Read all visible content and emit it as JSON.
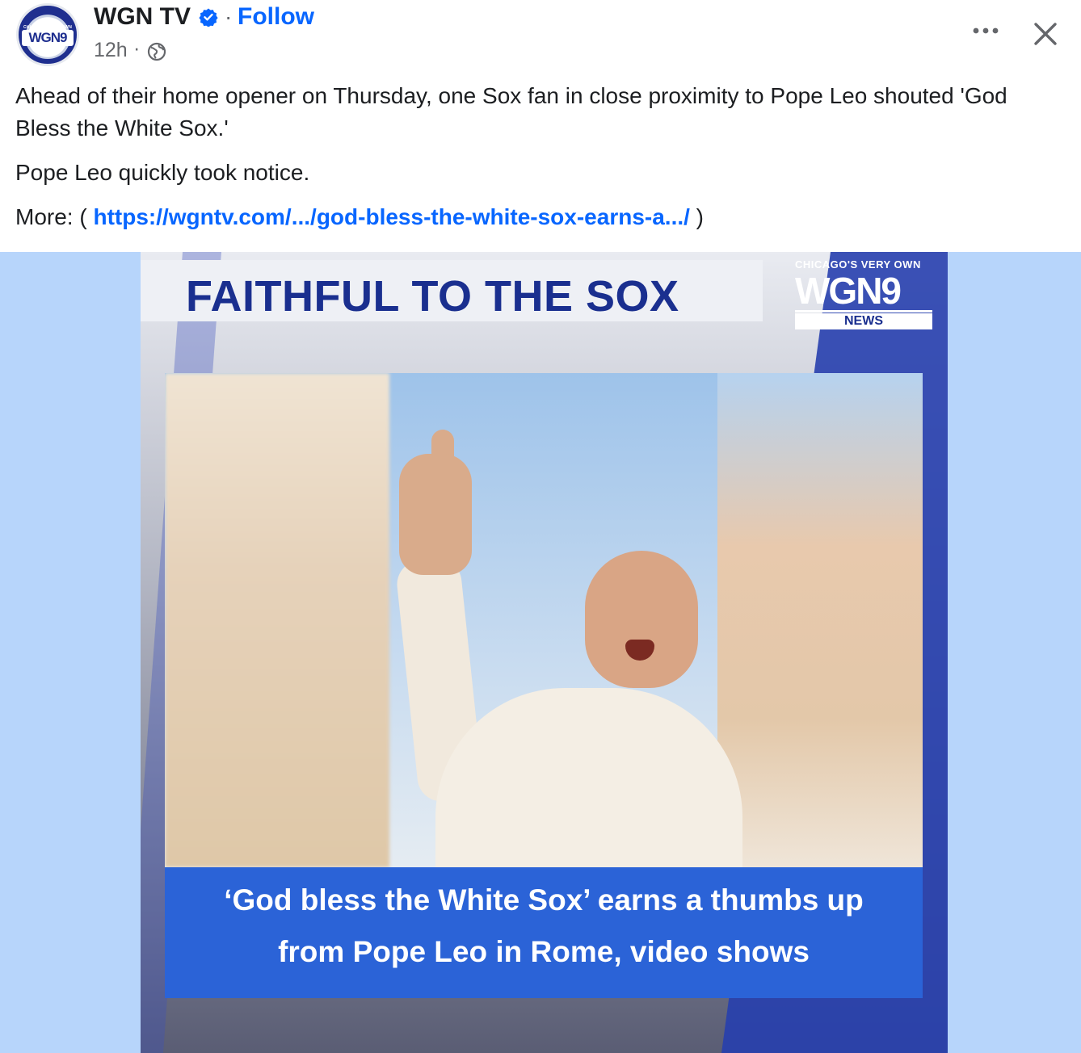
{
  "post": {
    "page_name": "WGN TV",
    "follow_label": "Follow",
    "separator": "·",
    "time": "12h",
    "time_separator": "·",
    "avatar_text": "WGN9",
    "avatar_tagline": "CHICAGO'S VERY OWN",
    "icons": {
      "verified": "verified-badge-icon",
      "audience": "globe-icon",
      "more": "more-options-icon",
      "close": "close-icon"
    },
    "colors": {
      "link": "#0866ff",
      "verified": "#0866ff",
      "media_bg": "#b7d5fb",
      "caption_bg": "#2b63d7",
      "brand_navy": "#1a2f8f"
    }
  },
  "body": {
    "paragraph1": "Ahead of their home opener on Thursday, one Sox fan in close proximity to Pope Leo shouted 'God Bless the White Sox.'",
    "paragraph2": "Pope Leo quickly took notice.",
    "more_prefix": "More: ( ",
    "link_text": "https://wgntv.com/.../god-bless-the-white-sox-earns-a.../",
    "more_suffix": " )"
  },
  "media": {
    "banner_title": "FAITHFUL TO THE SOX",
    "logo_tagline": "CHICAGO'S VERY OWN",
    "logo_text": "WGN9",
    "logo_subtitle": "NEWS",
    "caption_line1": "‘God bless the White Sox’ earns a thumbs up",
    "caption_line2": "from Pope Leo in Rome, video shows"
  }
}
